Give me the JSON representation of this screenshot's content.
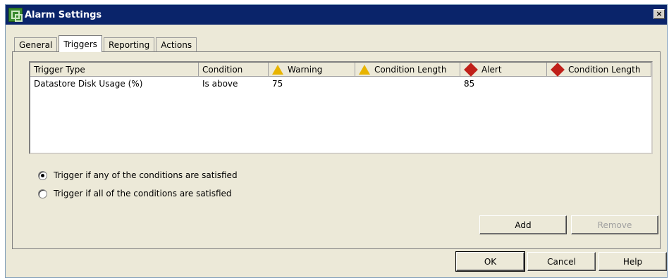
{
  "window": {
    "title": "Alarm Settings",
    "close_glyph": "×"
  },
  "tabs": [
    {
      "label": "General"
    },
    {
      "label": "Triggers"
    },
    {
      "label": "Reporting"
    },
    {
      "label": "Actions"
    }
  ],
  "table": {
    "columns": [
      "Trigger Type",
      "Condition",
      "Warning",
      "Condition Length",
      "Alert",
      "Condition Length"
    ],
    "rows": [
      {
        "trigger_type": "Datastore Disk Usage (%)",
        "condition": "Is above",
        "warning": "75",
        "warning_length": "",
        "alert": "85",
        "alert_length": ""
      }
    ]
  },
  "options": {
    "any": "Trigger if any of the conditions are satisfied",
    "all": "Trigger if all of the conditions are satisfied",
    "selected": "any"
  },
  "buttons": {
    "add": "Add",
    "remove": "Remove",
    "ok": "OK",
    "cancel": "Cancel",
    "help": "Help"
  },
  "colors": {
    "titlebar": "#0a246a",
    "warning": "#e8b400",
    "alert": "#c0201a"
  }
}
